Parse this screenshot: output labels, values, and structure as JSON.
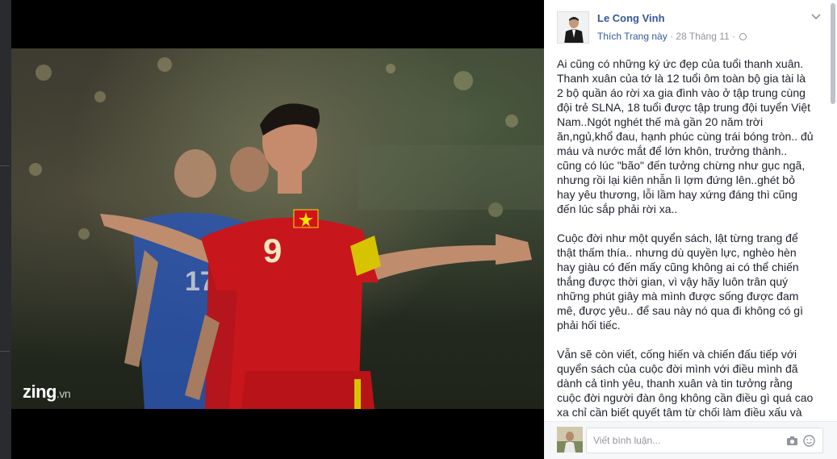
{
  "post": {
    "author": "Le Cong Vinh",
    "like_page": "Thích Trang này",
    "separator": "·",
    "date": "28 Tháng 11",
    "separator2": "·",
    "paragraphs": [
      "Ai cũng có những ký ức đẹp của tuổi thanh xuân. Thanh xuân của tớ là 12 tuổi ôm toàn bộ gia tài là 2 bộ quần áo rời xa gia đình vào ở tập trung cùng đội trẻ SLNA, 18 tuổi được tập trung đội tuyển Việt Nam..Ngót nghét thế mà gần 20 năm trời ăn,ngủ,khổ đau, hạnh phúc cùng trái bóng tròn.. đủ máu và nước mắt để lớn khôn, trưởng thành.. cũng có lúc \"bão\" đến tưởng chừng như gục ngã, nhưng rồi lại kiên nhẫn lì lợm đứng lên..ghét bỏ hay yêu thương, lỗi lầm hay xứng đáng thì cũng đến lúc sắp phải rời xa..",
      "Cuộc đời như một quyển sách, lật từng trang để thật thấm thía.. nhưng dù quyền lực, nghèo hèn hay giàu có đến mấy cũng không ai có thể chiến thắng được thời gian, vì vậy hãy luôn trân quý những phút giây mà mình được sống được đam mê, được yêu.. để sau này nó qua đi không có gì phải hối tiếc.",
      "Vẫn sẽ còn viết, cống hiến và chiến đấu tiếp với quyển sách của cuộc đời mình với điều mình đã dành cả tình yêu, thanh xuân và tin tưởng rằng cuộc đời người đàn ông không cần điều gì quá cao xa chỉ cần biết quyết tâm từ chối làm điều xấu và"
    ]
  },
  "photo": {
    "watermark_brand": "zing",
    "watermark_suffix": ".vn",
    "jersey_number": "9",
    "opponent_number": "17"
  },
  "comment": {
    "placeholder": "Viết bình luận..."
  },
  "icons": [
    "chevron-down-icon",
    "globe-icon",
    "camera-icon",
    "emoji-icon"
  ],
  "colors": {
    "link": "#365899",
    "meta": "#90949c",
    "text": "#1d2129",
    "jersey_red": "#c8161d",
    "stage": "#000000"
  }
}
